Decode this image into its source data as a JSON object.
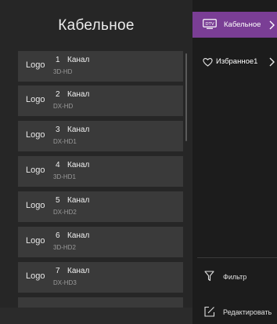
{
  "colors": {
    "accent": "#7a3e95",
    "background": "#1f1f1f",
    "panel": "#262626",
    "item": "#3a3a3a"
  },
  "left": {
    "title": "Кабельное",
    "channels": [
      {
        "logo": "Logo",
        "number": "1",
        "name": "Канал",
        "type": "3D-HD"
      },
      {
        "logo": "Logo",
        "number": "2",
        "name": "Канал",
        "type": "DX-HD"
      },
      {
        "logo": "Logo",
        "number": "3",
        "name": "Канал",
        "type": "DX-HD1"
      },
      {
        "logo": "Logo",
        "number": "4",
        "name": "Канал",
        "type": "3D-HD1"
      },
      {
        "logo": "Logo",
        "number": "5",
        "name": "Канал",
        "type": "DX-HD2"
      },
      {
        "logo": "Logo",
        "number": "6",
        "name": "Канал",
        "type": "3D-HD2"
      },
      {
        "logo": "Logo",
        "number": "7",
        "name": "Канал",
        "type": "DX-HD3"
      }
    ]
  },
  "right": {
    "tabs": [
      {
        "label": "Кабельное",
        "icon": "dtv-icon",
        "badge": "DTV"
      },
      {
        "label": "Избранное1",
        "icon": "heart-icon"
      }
    ],
    "actions": [
      {
        "label": "Фильтр",
        "icon": "filter-icon"
      },
      {
        "label": "Редактировать",
        "icon": "edit-icon"
      }
    ]
  }
}
